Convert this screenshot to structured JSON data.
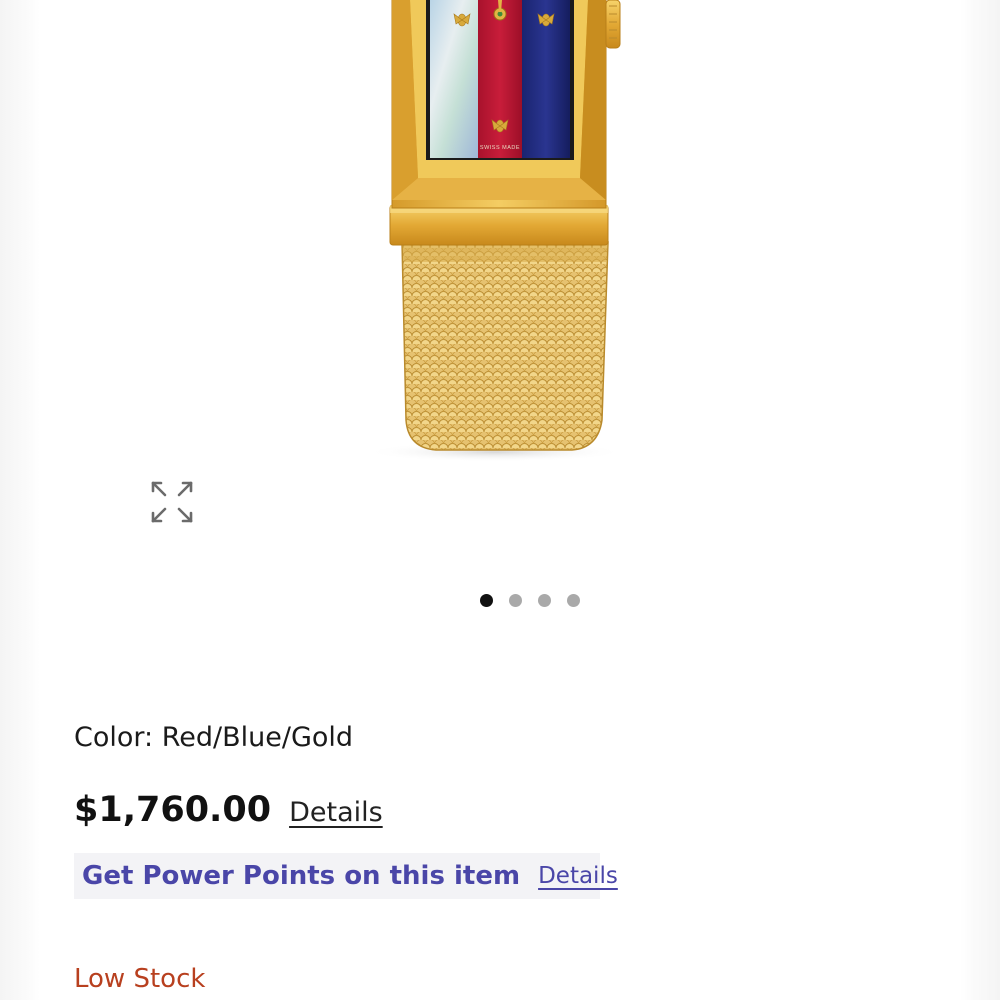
{
  "gallery": {
    "image_alt": "Gold rectangular watch with mother-of-pearl, red and blue striped dial and gold mesh bracelet",
    "dial_text": "SWISS MADE",
    "expand_icon": "expand-arrows-icon",
    "dots": [
      "slide-1",
      "slide-2",
      "slide-3",
      "slide-4"
    ],
    "active_dot": 0
  },
  "product": {
    "color_label": "Color:",
    "color_value": "Red/Blue/Gold",
    "price": "$1,760.00",
    "price_details_label": "Details",
    "power_points_text": "Get Power Points on this item",
    "power_points_details_label": "Details",
    "stock_status": "Low Stock"
  },
  "colors": {
    "power_points_text": "#4a46a8",
    "stock_status": "#b8401f",
    "active_dot": "#111111",
    "inactive_dot": "#a9a9a9"
  }
}
